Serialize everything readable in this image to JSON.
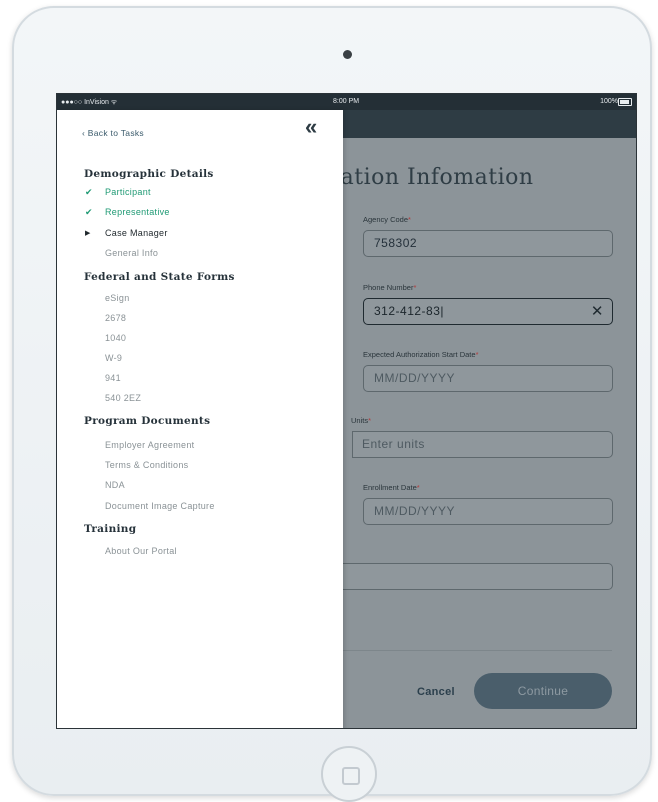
{
  "status_bar": {
    "carrier": "●●●○○ InVision ᯤ",
    "time": "8:00 PM",
    "battery": "100%"
  },
  "drawer": {
    "back_label": "‹ Back to Tasks",
    "collapse_icon": "«",
    "sections": [
      {
        "title": "Demographic Details",
        "items": [
          {
            "label": "Participant",
            "state": "done",
            "mark": "✔"
          },
          {
            "label": "Representative",
            "state": "done",
            "mark": "✔"
          },
          {
            "label": "Case Manager",
            "state": "current",
            "mark": "▶"
          },
          {
            "label": "General Info",
            "state": "todo",
            "mark": ""
          }
        ]
      },
      {
        "title": "Federal and State Forms",
        "items": [
          {
            "label": "eSign"
          },
          {
            "label": "2678"
          },
          {
            "label": "1040"
          },
          {
            "label": "W-9"
          },
          {
            "label": "941"
          },
          {
            "label": "540 2EZ"
          }
        ]
      },
      {
        "title": "Program Documents",
        "items": [
          {
            "label": "Employer Agreement"
          },
          {
            "label": "Terms & Conditions"
          },
          {
            "label": "NDA"
          },
          {
            "label": "Document Image Capture"
          }
        ]
      },
      {
        "title": "Training",
        "items": [
          {
            "label": "About Our Portal"
          }
        ]
      }
    ]
  },
  "form": {
    "title": "rization Infomation",
    "agency_code": {
      "label": "Agency Code",
      "required": "*",
      "value": "758302"
    },
    "phone_number": {
      "label": "Phone Number",
      "required": "*",
      "value": "312-412-83|",
      "clear_icon": "✕"
    },
    "start_date": {
      "label": "Expected Authorization Start Date",
      "required": "*",
      "placeholder": "MM/DD/YYYY"
    },
    "units": {
      "label": "Units",
      "required": "*",
      "placeholder": "Enter units"
    },
    "enrollment_date": {
      "label": "Enrollment Date",
      "required": "*",
      "placeholder": "MM/DD/YYYY"
    },
    "cancel_label": "Cancel",
    "continue_label": "Continue"
  }
}
